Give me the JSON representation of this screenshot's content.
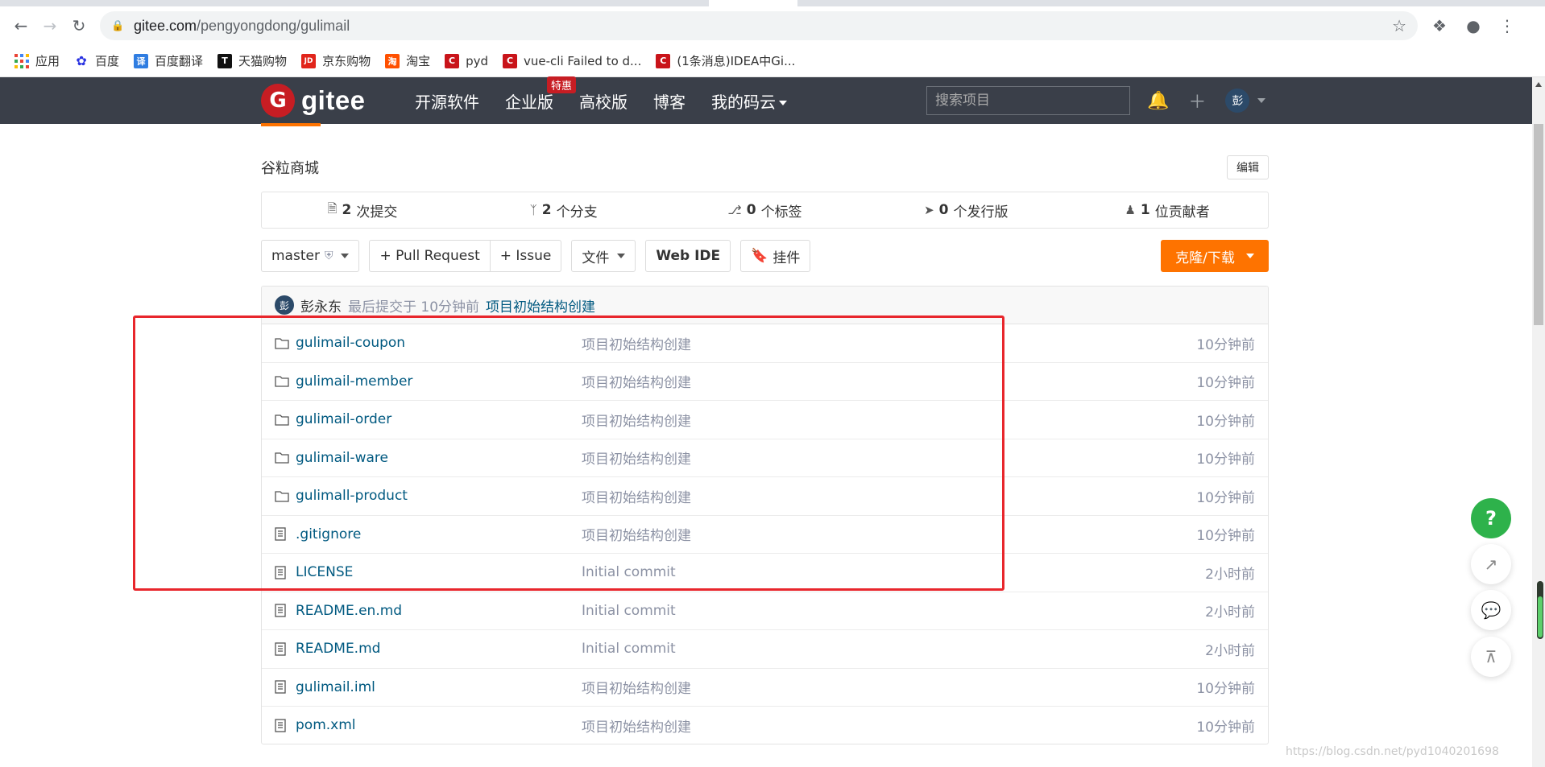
{
  "browser": {
    "url_host": "gitee.com",
    "url_path": "/pengyongdong/gulimail",
    "bookmarks": [
      {
        "label": "应用",
        "icon": "apps-grid-icon"
      },
      {
        "label": "百度",
        "icon": "baidu-paw-icon",
        "color": "#2932e1"
      },
      {
        "label": "百度翻译",
        "icon_text": "译",
        "color": "#2f7de1"
      },
      {
        "label": "天猫购物",
        "icon_text": "T",
        "color": "#111111"
      },
      {
        "label": "京东购物",
        "icon_text": "JD",
        "color": "#e1251b"
      },
      {
        "label": "淘宝",
        "icon_text": "淘",
        "color": "#ff5000"
      },
      {
        "label": "pyd",
        "icon_text": "C",
        "color": "#c9141a"
      },
      {
        "label": "vue-cli Failed to d...",
        "icon_text": "C",
        "color": "#c9141a"
      },
      {
        "label": "(1条消息)IDEA中Gi...",
        "icon_text": "C",
        "color": "#c9141a"
      }
    ]
  },
  "gitee_header": {
    "logo_letter": "G",
    "logo_text": "gitee",
    "nav": [
      "开源软件",
      "企业版",
      "高校版",
      "博客",
      "我的码云"
    ],
    "enterprise_badge": "特惠",
    "search_placeholder": "搜索项目",
    "avatar_text": "彭"
  },
  "repo": {
    "description": "谷粒商城",
    "edit_label": "编辑",
    "stats": [
      {
        "icon": "commit-icon",
        "count": "2",
        "label": "次提交"
      },
      {
        "icon": "branch-icon",
        "count": "2",
        "label": "个分支"
      },
      {
        "icon": "tag-icon",
        "count": "0",
        "label": "个标签"
      },
      {
        "icon": "release-icon",
        "count": "0",
        "label": "个发行版"
      },
      {
        "icon": "contributors-icon",
        "count": "1",
        "label": "位贡献者"
      }
    ],
    "toolbar": {
      "branch": "master",
      "pull_request": "+ Pull Request",
      "issue": "+ Issue",
      "files": "文件",
      "web_ide": "Web IDE",
      "widget": "挂件",
      "clone": "克隆/下载"
    },
    "last_commit": {
      "avatar_text": "彭",
      "author": "彭永东",
      "meta": "最后提交于 10分钟前",
      "message": "项目初始结构创建"
    },
    "files": [
      {
        "type": "folder",
        "name": "gulimail-coupon",
        "message": "项目初始结构创建",
        "time": "10分钟前"
      },
      {
        "type": "folder",
        "name": "gulimail-member",
        "message": "项目初始结构创建",
        "time": "10分钟前"
      },
      {
        "type": "folder",
        "name": "gulimail-order",
        "message": "项目初始结构创建",
        "time": "10分钟前"
      },
      {
        "type": "folder",
        "name": "gulimail-ware",
        "message": "项目初始结构创建",
        "time": "10分钟前"
      },
      {
        "type": "folder",
        "name": "gulimall-product",
        "message": "项目初始结构创建",
        "time": "10分钟前"
      },
      {
        "type": "file",
        "name": ".gitignore",
        "message": "项目初始结构创建",
        "time": "10分钟前"
      },
      {
        "type": "file",
        "name": "LICENSE",
        "message": "Initial commit",
        "time": "2小时前"
      },
      {
        "type": "file",
        "name": "README.en.md",
        "message": "Initial commit",
        "time": "2小时前"
      },
      {
        "type": "file",
        "name": "README.md",
        "message": "Initial commit",
        "time": "2小时前"
      },
      {
        "type": "file",
        "name": "gulimail.iml",
        "message": "项目初始结构创建",
        "time": "10分钟前"
      },
      {
        "type": "file",
        "name": "pom.xml",
        "message": "项目初始结构创建",
        "time": "10分钟前"
      }
    ]
  },
  "floating": {
    "help_label": "?",
    "side_level_fraction": 0.75
  },
  "watermark": "https://blog.csdn.net/pyd1040201698",
  "colors": {
    "header_bg": "#3a3f49",
    "accent_orange": "#fe7300",
    "link_blue": "#005980",
    "highlight_red": "#e8262c",
    "help_green": "#2eb24b"
  }
}
